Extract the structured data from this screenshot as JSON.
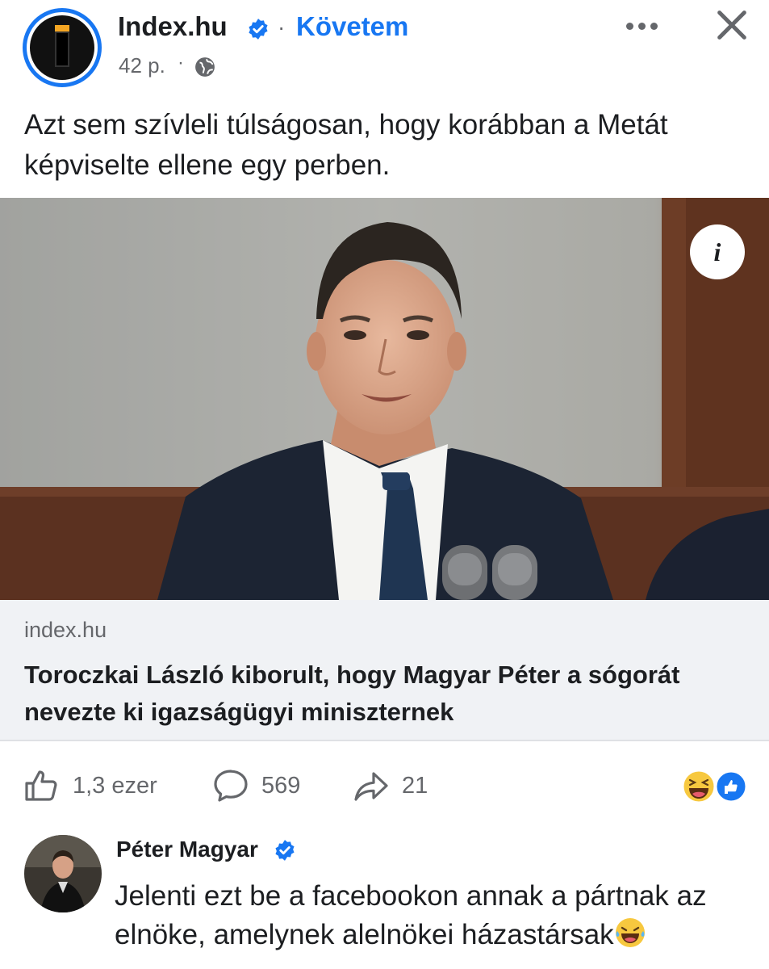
{
  "post": {
    "page_name": "Index.hu",
    "follow_label": "Követem",
    "time": "42 p.",
    "separator": "·",
    "caption": "Azt sem szívleli túlságosan, hogy korábban a Metát képviselte ellene egy perben."
  },
  "link_preview": {
    "domain": "index.hu",
    "title": "Toroczkai László kiborult, hogy Magyar Péter a sógorát nevezte ki igazságügyi miniszternek",
    "info_icon_label": "i"
  },
  "actions": {
    "likes": "1,3 ezer",
    "comments": "569",
    "shares": "21"
  },
  "comment": {
    "author": "Péter Magyar",
    "text": "Jelenti ezt be a facebookon annak a pártnak az elnöke, amelynek alelnökei házastársak"
  },
  "icons": {
    "verified": "verified-badge-icon",
    "globe": "globe-icon",
    "more": "more-options-icon",
    "close": "close-icon",
    "like": "thumbs-up-icon",
    "comment": "comment-bubble-icon",
    "share": "share-arrow-icon",
    "reaction_haha": "haha-reaction-icon",
    "reaction_like": "like-reaction-icon"
  },
  "colors": {
    "accent": "#1877f2",
    "secondary_text": "#65676b",
    "link_background": "#f0f2f5"
  }
}
